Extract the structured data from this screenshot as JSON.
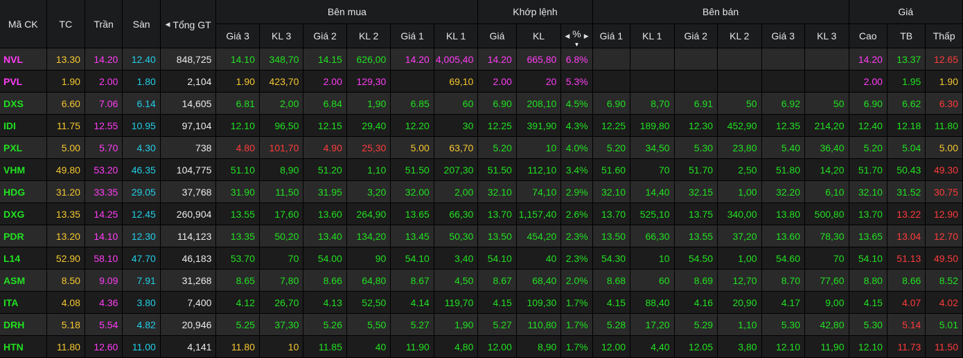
{
  "colors": {
    "green": "#21e121",
    "red": "#ff3b3b",
    "yellow": "#f6c830",
    "pink": "#ff3df5",
    "cyan": "#22cfe8",
    "white": "#ececec"
  },
  "headers": {
    "symbol": "Mã CK",
    "ref": "TC",
    "ceil": "Trần",
    "floor": "Sàn",
    "total": "Tổng GT",
    "bid_group": "Bên mua",
    "match_group": "Khớp lệnh",
    "ask_group": "Bên bán",
    "price_group": "Giá",
    "bid_cols": [
      "Giá 3",
      "KL 3",
      "Giá 2",
      "KL 2",
      "Giá 1",
      "KL 1"
    ],
    "match_cols": [
      "Giá",
      "KL",
      "%"
    ],
    "ask_cols": [
      "Giá 1",
      "KL 1",
      "Giá 2",
      "KL 2",
      "Giá 3",
      "KL 3"
    ],
    "price_cols": [
      "Cao",
      "TB",
      "Thấp"
    ],
    "sort_left_icon": "◀",
    "sort_right_icon": "▶",
    "sort_down_icon": "▼",
    "total_left_icon": "◀"
  },
  "rows": [
    {
      "cells": [
        [
          "NVL",
          "pink"
        ],
        [
          "13.30",
          "yellow"
        ],
        [
          "14.20",
          "pink"
        ],
        [
          "12.40",
          "cyan"
        ],
        [
          "848,725",
          "white"
        ],
        [
          "14.10",
          "green"
        ],
        [
          "348,70",
          "green"
        ],
        [
          "14.15",
          "green"
        ],
        [
          "626,00",
          "green"
        ],
        [
          "14.20",
          "pink"
        ],
        [
          "4,005,40",
          "pink"
        ],
        [
          "14.20",
          "pink"
        ],
        [
          "665,80",
          "pink"
        ],
        [
          "6.8%",
          "pink"
        ],
        [
          "",
          ""
        ],
        [
          "",
          ""
        ],
        [
          "",
          ""
        ],
        [
          "",
          ""
        ],
        [
          "",
          ""
        ],
        [
          "",
          ""
        ],
        [
          "14.20",
          "pink"
        ],
        [
          "13.37",
          "green"
        ],
        [
          "12.65",
          "red"
        ]
      ]
    },
    {
      "cells": [
        [
          "PVL",
          "pink"
        ],
        [
          "1.90",
          "yellow"
        ],
        [
          "2.00",
          "pink"
        ],
        [
          "1.80",
          "cyan"
        ],
        [
          "2,104",
          "white"
        ],
        [
          "1.90",
          "yellow"
        ],
        [
          "423,70",
          "yellow"
        ],
        [
          "2.00",
          "pink"
        ],
        [
          "129,30",
          "pink"
        ],
        [
          "",
          ""
        ],
        [
          "69,10",
          "yellow"
        ],
        [
          "2.00",
          "pink"
        ],
        [
          "20",
          "pink"
        ],
        [
          "5.3%",
          "pink"
        ],
        [
          "",
          ""
        ],
        [
          "",
          ""
        ],
        [
          "",
          ""
        ],
        [
          "",
          ""
        ],
        [
          "",
          ""
        ],
        [
          "",
          ""
        ],
        [
          "2.00",
          "pink"
        ],
        [
          "1.95",
          "green"
        ],
        [
          "1.90",
          "yellow"
        ]
      ]
    },
    {
      "cells": [
        [
          "DXS",
          "green"
        ],
        [
          "6.60",
          "yellow"
        ],
        [
          "7.06",
          "pink"
        ],
        [
          "6.14",
          "cyan"
        ],
        [
          "14,605",
          "white"
        ],
        [
          "6.81",
          "green"
        ],
        [
          "2,00",
          "green"
        ],
        [
          "6.84",
          "green"
        ],
        [
          "1,90",
          "green"
        ],
        [
          "6.85",
          "green"
        ],
        [
          "60",
          "green"
        ],
        [
          "6.90",
          "green"
        ],
        [
          "208,10",
          "green"
        ],
        [
          "4.5%",
          "green"
        ],
        [
          "6.90",
          "green"
        ],
        [
          "8,70",
          "green"
        ],
        [
          "6.91",
          "green"
        ],
        [
          "50",
          "green"
        ],
        [
          "6.92",
          "green"
        ],
        [
          "50",
          "green"
        ],
        [
          "6.90",
          "green"
        ],
        [
          "6.62",
          "green"
        ],
        [
          "6.30",
          "red"
        ]
      ]
    },
    {
      "cells": [
        [
          "IDI",
          "green"
        ],
        [
          "11.75",
          "yellow"
        ],
        [
          "12.55",
          "pink"
        ],
        [
          "10.95",
          "cyan"
        ],
        [
          "97,104",
          "white"
        ],
        [
          "12.10",
          "green"
        ],
        [
          "96,50",
          "green"
        ],
        [
          "12.15",
          "green"
        ],
        [
          "29,40",
          "green"
        ],
        [
          "12.20",
          "green"
        ],
        [
          "30",
          "green"
        ],
        [
          "12.25",
          "green"
        ],
        [
          "391,90",
          "green"
        ],
        [
          "4.3%",
          "green"
        ],
        [
          "12.25",
          "green"
        ],
        [
          "189,80",
          "green"
        ],
        [
          "12.30",
          "green"
        ],
        [
          "452,90",
          "green"
        ],
        [
          "12.35",
          "green"
        ],
        [
          "214,20",
          "green"
        ],
        [
          "12.40",
          "green"
        ],
        [
          "12.18",
          "green"
        ],
        [
          "11.80",
          "green"
        ]
      ]
    },
    {
      "cells": [
        [
          "PXL",
          "green"
        ],
        [
          "5.00",
          "yellow"
        ],
        [
          "5.70",
          "pink"
        ],
        [
          "4.30",
          "cyan"
        ],
        [
          "738",
          "white"
        ],
        [
          "4.80",
          "red"
        ],
        [
          "101,70",
          "red"
        ],
        [
          "4.90",
          "red"
        ],
        [
          "25,30",
          "red"
        ],
        [
          "5.00",
          "yellow"
        ],
        [
          "63,70",
          "yellow"
        ],
        [
          "5.20",
          "green"
        ],
        [
          "10",
          "green"
        ],
        [
          "4.0%",
          "green"
        ],
        [
          "5.20",
          "green"
        ],
        [
          "34,50",
          "green"
        ],
        [
          "5.30",
          "green"
        ],
        [
          "23,80",
          "green"
        ],
        [
          "5.40",
          "green"
        ],
        [
          "36,40",
          "green"
        ],
        [
          "5.20",
          "green"
        ],
        [
          "5.04",
          "green"
        ],
        [
          "5.00",
          "yellow"
        ]
      ]
    },
    {
      "cells": [
        [
          "VHM",
          "green"
        ],
        [
          "49.80",
          "yellow"
        ],
        [
          "53.20",
          "pink"
        ],
        [
          "46.35",
          "cyan"
        ],
        [
          "104,775",
          "white"
        ],
        [
          "51.10",
          "green"
        ],
        [
          "8,90",
          "green"
        ],
        [
          "51.20",
          "green"
        ],
        [
          "1,10",
          "green"
        ],
        [
          "51.50",
          "green"
        ],
        [
          "207,30",
          "green"
        ],
        [
          "51.50",
          "green"
        ],
        [
          "112,10",
          "green"
        ],
        [
          "3.4%",
          "green"
        ],
        [
          "51.60",
          "green"
        ],
        [
          "70",
          "green"
        ],
        [
          "51.70",
          "green"
        ],
        [
          "2,50",
          "green"
        ],
        [
          "51.80",
          "green"
        ],
        [
          "14,20",
          "green"
        ],
        [
          "51.70",
          "green"
        ],
        [
          "50.43",
          "green"
        ],
        [
          "49.30",
          "red"
        ]
      ]
    },
    {
      "cells": [
        [
          "HDG",
          "green"
        ],
        [
          "31.20",
          "yellow"
        ],
        [
          "33.35",
          "pink"
        ],
        [
          "29.05",
          "cyan"
        ],
        [
          "37,768",
          "white"
        ],
        [
          "31.90",
          "green"
        ],
        [
          "11,50",
          "green"
        ],
        [
          "31.95",
          "green"
        ],
        [
          "3,20",
          "green"
        ],
        [
          "32.00",
          "green"
        ],
        [
          "2,00",
          "green"
        ],
        [
          "32.10",
          "green"
        ],
        [
          "74,10",
          "green"
        ],
        [
          "2.9%",
          "green"
        ],
        [
          "32.10",
          "green"
        ],
        [
          "14,40",
          "green"
        ],
        [
          "32.15",
          "green"
        ],
        [
          "1,00",
          "green"
        ],
        [
          "32.20",
          "green"
        ],
        [
          "6,10",
          "green"
        ],
        [
          "32.10",
          "green"
        ],
        [
          "31.52",
          "green"
        ],
        [
          "30.75",
          "red"
        ]
      ]
    },
    {
      "cells": [
        [
          "DXG",
          "green"
        ],
        [
          "13.35",
          "yellow"
        ],
        [
          "14.25",
          "pink"
        ],
        [
          "12.45",
          "cyan"
        ],
        [
          "260,904",
          "white"
        ],
        [
          "13.55",
          "green"
        ],
        [
          "17,60",
          "green"
        ],
        [
          "13.60",
          "green"
        ],
        [
          "264,90",
          "green"
        ],
        [
          "13.65",
          "green"
        ],
        [
          "66,30",
          "green"
        ],
        [
          "13.70",
          "green"
        ],
        [
          "1,157,40",
          "green"
        ],
        [
          "2.6%",
          "green"
        ],
        [
          "13.70",
          "green"
        ],
        [
          "525,10",
          "green"
        ],
        [
          "13.75",
          "green"
        ],
        [
          "340,00",
          "green"
        ],
        [
          "13.80",
          "green"
        ],
        [
          "500,80",
          "green"
        ],
        [
          "13.70",
          "green"
        ],
        [
          "13.22",
          "red"
        ],
        [
          "12.90",
          "red"
        ]
      ]
    },
    {
      "cells": [
        [
          "PDR",
          "green"
        ],
        [
          "13.20",
          "yellow"
        ],
        [
          "14.10",
          "pink"
        ],
        [
          "12.30",
          "cyan"
        ],
        [
          "114,123",
          "white"
        ],
        [
          "13.35",
          "green"
        ],
        [
          "50,20",
          "green"
        ],
        [
          "13.40",
          "green"
        ],
        [
          "134,20",
          "green"
        ],
        [
          "13.45",
          "green"
        ],
        [
          "50,30",
          "green"
        ],
        [
          "13.50",
          "green"
        ],
        [
          "454,20",
          "green"
        ],
        [
          "2.3%",
          "green"
        ],
        [
          "13.50",
          "green"
        ],
        [
          "66,30",
          "green"
        ],
        [
          "13.55",
          "green"
        ],
        [
          "37,20",
          "green"
        ],
        [
          "13.60",
          "green"
        ],
        [
          "78,30",
          "green"
        ],
        [
          "13.65",
          "green"
        ],
        [
          "13.04",
          "red"
        ],
        [
          "12.70",
          "red"
        ]
      ]
    },
    {
      "cells": [
        [
          "L14",
          "green"
        ],
        [
          "52.90",
          "yellow"
        ],
        [
          "58.10",
          "pink"
        ],
        [
          "47.70",
          "cyan"
        ],
        [
          "46,183",
          "white"
        ],
        [
          "53.70",
          "green"
        ],
        [
          "70",
          "green"
        ],
        [
          "54.00",
          "green"
        ],
        [
          "90",
          "green"
        ],
        [
          "54.10",
          "green"
        ],
        [
          "3,40",
          "green"
        ],
        [
          "54.10",
          "green"
        ],
        [
          "40",
          "green"
        ],
        [
          "2.3%",
          "green"
        ],
        [
          "54.30",
          "green"
        ],
        [
          "10",
          "green"
        ],
        [
          "54.50",
          "green"
        ],
        [
          "1,00",
          "green"
        ],
        [
          "54.60",
          "green"
        ],
        [
          "70",
          "green"
        ],
        [
          "54.10",
          "green"
        ],
        [
          "51.13",
          "red"
        ],
        [
          "49.50",
          "red"
        ]
      ]
    },
    {
      "cells": [
        [
          "ASM",
          "green"
        ],
        [
          "8.50",
          "yellow"
        ],
        [
          "9.09",
          "pink"
        ],
        [
          "7.91",
          "cyan"
        ],
        [
          "31,268",
          "white"
        ],
        [
          "8.65",
          "green"
        ],
        [
          "7,80",
          "green"
        ],
        [
          "8.66",
          "green"
        ],
        [
          "64,80",
          "green"
        ],
        [
          "8.67",
          "green"
        ],
        [
          "4,50",
          "green"
        ],
        [
          "8.67",
          "green"
        ],
        [
          "68,40",
          "green"
        ],
        [
          "2.0%",
          "green"
        ],
        [
          "8.68",
          "green"
        ],
        [
          "60",
          "green"
        ],
        [
          "8.69",
          "green"
        ],
        [
          "12,70",
          "green"
        ],
        [
          "8.70",
          "green"
        ],
        [
          "77,60",
          "green"
        ],
        [
          "8.80",
          "green"
        ],
        [
          "8.66",
          "green"
        ],
        [
          "8.52",
          "green"
        ]
      ]
    },
    {
      "cells": [
        [
          "ITA",
          "green"
        ],
        [
          "4.08",
          "yellow"
        ],
        [
          "4.36",
          "pink"
        ],
        [
          "3.80",
          "cyan"
        ],
        [
          "7,400",
          "white"
        ],
        [
          "4.12",
          "green"
        ],
        [
          "26,70",
          "green"
        ],
        [
          "4.13",
          "green"
        ],
        [
          "52,50",
          "green"
        ],
        [
          "4.14",
          "green"
        ],
        [
          "119,70",
          "green"
        ],
        [
          "4.15",
          "green"
        ],
        [
          "109,30",
          "green"
        ],
        [
          "1.7%",
          "green"
        ],
        [
          "4.15",
          "green"
        ],
        [
          "88,40",
          "green"
        ],
        [
          "4.16",
          "green"
        ],
        [
          "20,90",
          "green"
        ],
        [
          "4.17",
          "green"
        ],
        [
          "9,00",
          "green"
        ],
        [
          "4.15",
          "green"
        ],
        [
          "4.07",
          "red"
        ],
        [
          "4.02",
          "red"
        ]
      ]
    },
    {
      "cells": [
        [
          "DRH",
          "green"
        ],
        [
          "5.18",
          "yellow"
        ],
        [
          "5.54",
          "pink"
        ],
        [
          "4.82",
          "cyan"
        ],
        [
          "20,946",
          "white"
        ],
        [
          "5.25",
          "green"
        ],
        [
          "37,30",
          "green"
        ],
        [
          "5.26",
          "green"
        ],
        [
          "5,50",
          "green"
        ],
        [
          "5.27",
          "green"
        ],
        [
          "1,90",
          "green"
        ],
        [
          "5.27",
          "green"
        ],
        [
          "110,80",
          "green"
        ],
        [
          "1.7%",
          "green"
        ],
        [
          "5.28",
          "green"
        ],
        [
          "17,20",
          "green"
        ],
        [
          "5.29",
          "green"
        ],
        [
          "1,10",
          "green"
        ],
        [
          "5.30",
          "green"
        ],
        [
          "42,80",
          "green"
        ],
        [
          "5.30",
          "green"
        ],
        [
          "5.14",
          "red"
        ],
        [
          "5.01",
          "green"
        ]
      ]
    },
    {
      "cells": [
        [
          "HTN",
          "green"
        ],
        [
          "11.80",
          "yellow"
        ],
        [
          "12.60",
          "pink"
        ],
        [
          "11.00",
          "cyan"
        ],
        [
          "4,141",
          "white"
        ],
        [
          "11.80",
          "yellow"
        ],
        [
          "10",
          "yellow"
        ],
        [
          "11.85",
          "green"
        ],
        [
          "40",
          "green"
        ],
        [
          "11.90",
          "green"
        ],
        [
          "4,80",
          "green"
        ],
        [
          "12.00",
          "green"
        ],
        [
          "8,90",
          "green"
        ],
        [
          "1.7%",
          "green"
        ],
        [
          "12.00",
          "green"
        ],
        [
          "4,40",
          "green"
        ],
        [
          "12.05",
          "green"
        ],
        [
          "3,80",
          "green"
        ],
        [
          "12.10",
          "green"
        ],
        [
          "11,90",
          "green"
        ],
        [
          "12.10",
          "green"
        ],
        [
          "11.73",
          "red"
        ],
        [
          "11.50",
          "red"
        ]
      ]
    }
  ]
}
